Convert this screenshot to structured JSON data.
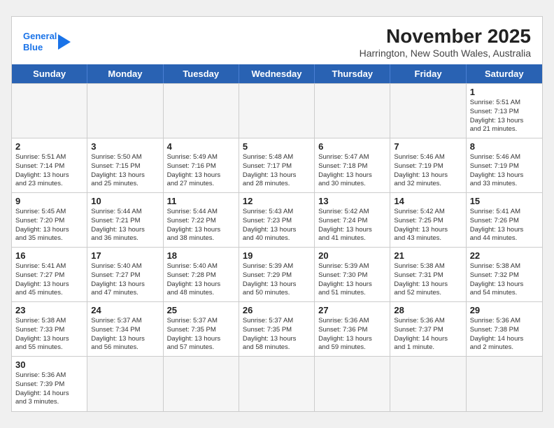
{
  "header": {
    "logo_line1": "General",
    "logo_line2": "Blue",
    "month_title": "November 2025",
    "subtitle": "Harrington, New South Wales, Australia"
  },
  "day_headers": [
    "Sunday",
    "Monday",
    "Tuesday",
    "Wednesday",
    "Thursday",
    "Friday",
    "Saturday"
  ],
  "weeks": [
    [
      {
        "num": "",
        "info": "",
        "empty": true
      },
      {
        "num": "",
        "info": "",
        "empty": true
      },
      {
        "num": "",
        "info": "",
        "empty": true
      },
      {
        "num": "",
        "info": "",
        "empty": true
      },
      {
        "num": "",
        "info": "",
        "empty": true
      },
      {
        "num": "",
        "info": "",
        "empty": true
      },
      {
        "num": "1",
        "info": "Sunrise: 5:51 AM\nSunset: 7:13 PM\nDaylight: 13 hours\nand 21 minutes.",
        "empty": false
      }
    ],
    [
      {
        "num": "2",
        "info": "Sunrise: 5:51 AM\nSunset: 7:14 PM\nDaylight: 13 hours\nand 23 minutes.",
        "empty": false
      },
      {
        "num": "3",
        "info": "Sunrise: 5:50 AM\nSunset: 7:15 PM\nDaylight: 13 hours\nand 25 minutes.",
        "empty": false
      },
      {
        "num": "4",
        "info": "Sunrise: 5:49 AM\nSunset: 7:16 PM\nDaylight: 13 hours\nand 27 minutes.",
        "empty": false
      },
      {
        "num": "5",
        "info": "Sunrise: 5:48 AM\nSunset: 7:17 PM\nDaylight: 13 hours\nand 28 minutes.",
        "empty": false
      },
      {
        "num": "6",
        "info": "Sunrise: 5:47 AM\nSunset: 7:18 PM\nDaylight: 13 hours\nand 30 minutes.",
        "empty": false
      },
      {
        "num": "7",
        "info": "Sunrise: 5:46 AM\nSunset: 7:19 PM\nDaylight: 13 hours\nand 32 minutes.",
        "empty": false
      },
      {
        "num": "8",
        "info": "Sunrise: 5:46 AM\nSunset: 7:19 PM\nDaylight: 13 hours\nand 33 minutes.",
        "empty": false
      }
    ],
    [
      {
        "num": "9",
        "info": "Sunrise: 5:45 AM\nSunset: 7:20 PM\nDaylight: 13 hours\nand 35 minutes.",
        "empty": false
      },
      {
        "num": "10",
        "info": "Sunrise: 5:44 AM\nSunset: 7:21 PM\nDaylight: 13 hours\nand 36 minutes.",
        "empty": false
      },
      {
        "num": "11",
        "info": "Sunrise: 5:44 AM\nSunset: 7:22 PM\nDaylight: 13 hours\nand 38 minutes.",
        "empty": false
      },
      {
        "num": "12",
        "info": "Sunrise: 5:43 AM\nSunset: 7:23 PM\nDaylight: 13 hours\nand 40 minutes.",
        "empty": false
      },
      {
        "num": "13",
        "info": "Sunrise: 5:42 AM\nSunset: 7:24 PM\nDaylight: 13 hours\nand 41 minutes.",
        "empty": false
      },
      {
        "num": "14",
        "info": "Sunrise: 5:42 AM\nSunset: 7:25 PM\nDaylight: 13 hours\nand 43 minutes.",
        "empty": false
      },
      {
        "num": "15",
        "info": "Sunrise: 5:41 AM\nSunset: 7:26 PM\nDaylight: 13 hours\nand 44 minutes.",
        "empty": false
      }
    ],
    [
      {
        "num": "16",
        "info": "Sunrise: 5:41 AM\nSunset: 7:27 PM\nDaylight: 13 hours\nand 45 minutes.",
        "empty": false
      },
      {
        "num": "17",
        "info": "Sunrise: 5:40 AM\nSunset: 7:27 PM\nDaylight: 13 hours\nand 47 minutes.",
        "empty": false
      },
      {
        "num": "18",
        "info": "Sunrise: 5:40 AM\nSunset: 7:28 PM\nDaylight: 13 hours\nand 48 minutes.",
        "empty": false
      },
      {
        "num": "19",
        "info": "Sunrise: 5:39 AM\nSunset: 7:29 PM\nDaylight: 13 hours\nand 50 minutes.",
        "empty": false
      },
      {
        "num": "20",
        "info": "Sunrise: 5:39 AM\nSunset: 7:30 PM\nDaylight: 13 hours\nand 51 minutes.",
        "empty": false
      },
      {
        "num": "21",
        "info": "Sunrise: 5:38 AM\nSunset: 7:31 PM\nDaylight: 13 hours\nand 52 minutes.",
        "empty": false
      },
      {
        "num": "22",
        "info": "Sunrise: 5:38 AM\nSunset: 7:32 PM\nDaylight: 13 hours\nand 54 minutes.",
        "empty": false
      }
    ],
    [
      {
        "num": "23",
        "info": "Sunrise: 5:38 AM\nSunset: 7:33 PM\nDaylight: 13 hours\nand 55 minutes.",
        "empty": false
      },
      {
        "num": "24",
        "info": "Sunrise: 5:37 AM\nSunset: 7:34 PM\nDaylight: 13 hours\nand 56 minutes.",
        "empty": false
      },
      {
        "num": "25",
        "info": "Sunrise: 5:37 AM\nSunset: 7:35 PM\nDaylight: 13 hours\nand 57 minutes.",
        "empty": false
      },
      {
        "num": "26",
        "info": "Sunrise: 5:37 AM\nSunset: 7:35 PM\nDaylight: 13 hours\nand 58 minutes.",
        "empty": false
      },
      {
        "num": "27",
        "info": "Sunrise: 5:36 AM\nSunset: 7:36 PM\nDaylight: 13 hours\nand 59 minutes.",
        "empty": false
      },
      {
        "num": "28",
        "info": "Sunrise: 5:36 AM\nSunset: 7:37 PM\nDaylight: 14 hours\nand 1 minute.",
        "empty": false
      },
      {
        "num": "29",
        "info": "Sunrise: 5:36 AM\nSunset: 7:38 PM\nDaylight: 14 hours\nand 2 minutes.",
        "empty": false
      }
    ],
    [
      {
        "num": "30",
        "info": "Sunrise: 5:36 AM\nSunset: 7:39 PM\nDaylight: 14 hours\nand 3 minutes.",
        "empty": false
      },
      {
        "num": "",
        "info": "",
        "empty": true
      },
      {
        "num": "",
        "info": "",
        "empty": true
      },
      {
        "num": "",
        "info": "",
        "empty": true
      },
      {
        "num": "",
        "info": "",
        "empty": true
      },
      {
        "num": "",
        "info": "",
        "empty": true
      },
      {
        "num": "",
        "info": "",
        "empty": true
      }
    ]
  ]
}
